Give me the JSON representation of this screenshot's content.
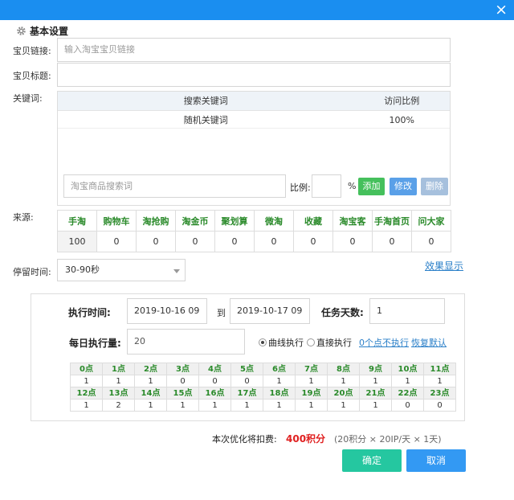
{
  "close_icon": "×",
  "section_title": "基本设置",
  "form": {
    "link_label": "宝贝链接:",
    "link_placeholder": "输入淘宝宝贝链接",
    "title_label": "宝贝标题:",
    "title_value": "",
    "keywords_label": "关键词:",
    "keywords_table": {
      "headers": [
        "搜索关键词",
        "访问比例"
      ],
      "rows": [
        [
          "随机关键词",
          "100%"
        ]
      ]
    },
    "keyword_input_placeholder": "淘宝商品搜索词",
    "ratio_label": "比例:",
    "ratio_value": "",
    "percent_sign": "%",
    "add_button": "添加",
    "edit_button": "修改",
    "delete_button": "删除",
    "source_label": "来源:",
    "sources": {
      "headers": [
        "手淘",
        "购物车",
        "淘抢购",
        "淘金币",
        "聚划算",
        "微淘",
        "收藏",
        "淘宝客",
        "手淘首页",
        "问大家"
      ],
      "values": [
        "100",
        "0",
        "0",
        "0",
        "0",
        "0",
        "0",
        "0",
        "0",
        "0"
      ]
    },
    "stay_time_label": "停留时间:",
    "stay_time_value": "30-90秒",
    "effect_link": "效果显示"
  },
  "schedule": {
    "exec_time_label": "执行时间:",
    "start_time": "2019-10-16 09",
    "to_label": "到",
    "end_time": "2019-10-17 09",
    "task_days_label": "任务天数:",
    "task_days_value": "1",
    "daily_label": "每日执行量:",
    "daily_value": "20",
    "curve_option": "曲线执行",
    "direct_option": "直接执行",
    "selected_mode": "curve",
    "zero_link": "0个点不执行",
    "restore_link": "恢复默认",
    "hours_top": [
      "0点",
      "1点",
      "2点",
      "3点",
      "4点",
      "5点",
      "6点",
      "7点",
      "8点",
      "9点",
      "10点",
      "11点"
    ],
    "values_top": [
      "1",
      "1",
      "1",
      "0",
      "0",
      "0",
      "1",
      "1",
      "1",
      "1",
      "1",
      "1"
    ],
    "hours_bottom": [
      "12点",
      "13点",
      "14点",
      "15点",
      "16点",
      "17点",
      "18点",
      "19点",
      "20点",
      "21点",
      "22点",
      "23点"
    ],
    "values_bottom": [
      "1",
      "2",
      "1",
      "1",
      "1",
      "1",
      "1",
      "1",
      "1",
      "1",
      "0",
      "0"
    ]
  },
  "cost": {
    "label": "本次优化将扣费:",
    "amount": "400积分",
    "detail": "(20积分 × 20IP/天 × 1天)"
  },
  "actions": {
    "confirm": "确定",
    "cancel": "取消"
  },
  "colors": {
    "titlebar": "#1a8ef0",
    "add_green": "#45c05c",
    "edit_blue": "#5aa0e8",
    "delete_gray": "#a6c0dd",
    "confirm_teal": "#25c7a0",
    "cancel_blue": "#3399f3",
    "cost_red": "#e02020",
    "header_green": "#2a8a2a"
  }
}
